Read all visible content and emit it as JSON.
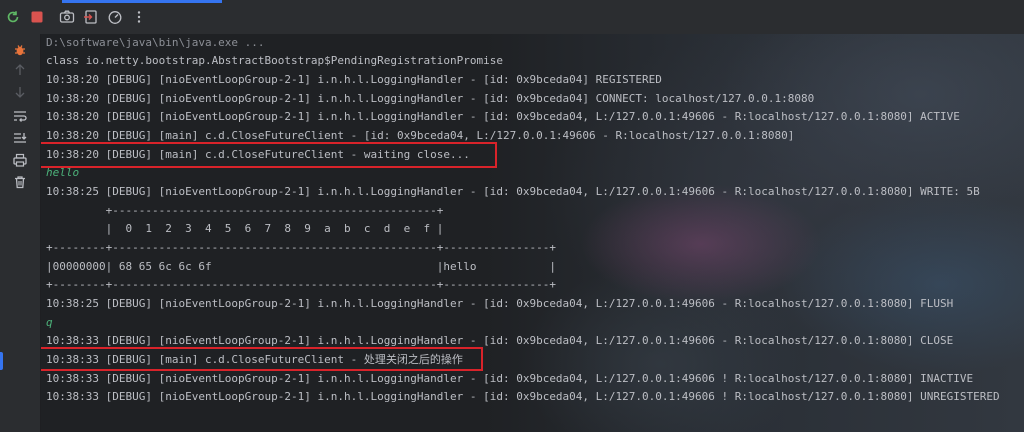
{
  "toolbar": {
    "buttons": [
      {
        "name": "rerun-icon",
        "color": "#5fb865"
      },
      {
        "name": "stop-icon",
        "color": "#d9534f"
      },
      {
        "name": "camera-icon",
        "color": "#bcbec4"
      },
      {
        "name": "exit-icon",
        "color": "#bcbec4"
      },
      {
        "name": "dashboard-icon",
        "color": "#bcbec4"
      },
      {
        "name": "more-icon",
        "color": "#bcbec4"
      }
    ]
  },
  "gutter": {
    "buttons": [
      "bug-icon",
      "arrow-up-icon",
      "arrow-down-icon",
      "soft-wrap-icon",
      "scroll-to-end-icon",
      "print-icon",
      "trash-icon"
    ]
  },
  "console": {
    "lines": [
      {
        "text": "D:\\software\\java\\bin\\java.exe ...",
        "style": "gray"
      },
      {
        "text": "class io.netty.bootstrap.AbstractBootstrap$PendingRegistrationPromise",
        "style": "normal"
      },
      {
        "text": "10:38:20 [DEBUG] [nioEventLoopGroup-2-1] i.n.h.l.LoggingHandler - [id: 0x9bceda04] REGISTERED",
        "style": "normal"
      },
      {
        "text": "10:38:20 [DEBUG] [nioEventLoopGroup-2-1] i.n.h.l.LoggingHandler - [id: 0x9bceda04] CONNECT: localhost/127.0.0.1:8080",
        "style": "normal"
      },
      {
        "text": "10:38:20 [DEBUG] [nioEventLoopGroup-2-1] i.n.h.l.LoggingHandler - [id: 0x9bceda04, L:/127.0.0.1:49606 - R:localhost/127.0.0.1:8080] ACTIVE",
        "style": "normal"
      },
      {
        "text": "10:38:20 [DEBUG] [main] c.d.CloseFutureClient - [id: 0x9bceda04, L:/127.0.0.1:49606 - R:localhost/127.0.0.1:8080]",
        "style": "normal"
      },
      {
        "text": "10:38:20 [DEBUG] [main] c.d.CloseFutureClient - waiting close...",
        "style": "normal"
      },
      {
        "text": "hello",
        "style": "italic"
      },
      {
        "text": "10:38:25 [DEBUG] [nioEventLoopGroup-2-1] i.n.h.l.LoggingHandler - [id: 0x9bceda04, L:/127.0.0.1:49606 - R:localhost/127.0.0.1:8080] WRITE: 5B",
        "style": "normal"
      },
      {
        "text": "         +-------------------------------------------------+",
        "style": "normal"
      },
      {
        "text": "         |  0  1  2  3  4  5  6  7  8  9  a  b  c  d  e  f |",
        "style": "normal"
      },
      {
        "text": "+--------+-------------------------------------------------+----------------+",
        "style": "normal"
      },
      {
        "text": "|00000000| 68 65 6c 6c 6f                                  |hello           |",
        "style": "normal"
      },
      {
        "text": "+--------+-------------------------------------------------+----------------+",
        "style": "normal"
      },
      {
        "text": "10:38:25 [DEBUG] [nioEventLoopGroup-2-1] i.n.h.l.LoggingHandler - [id: 0x9bceda04, L:/127.0.0.1:49606 - R:localhost/127.0.0.1:8080] FLUSH",
        "style": "normal"
      },
      {
        "text": "q",
        "style": "italic"
      },
      {
        "text": "10:38:33 [DEBUG] [nioEventLoopGroup-2-1] i.n.h.l.LoggingHandler - [id: 0x9bceda04, L:/127.0.0.1:49606 - R:localhost/127.0.0.1:8080] CLOSE",
        "style": "normal"
      },
      {
        "text": "10:38:33 [DEBUG] [main] c.d.CloseFutureClient - 处理关闭之后的操作",
        "style": "normal"
      },
      {
        "text": "10:38:33 [DEBUG] [nioEventLoopGroup-2-1] i.n.h.l.LoggingHandler - [id: 0x9bceda04, L:/127.0.0.1:49606 ! R:localhost/127.0.0.1:8080] INACTIVE",
        "style": "normal"
      },
      {
        "text": "10:38:33 [DEBUG] [nioEventLoopGroup-2-1] i.n.h.l.LoggingHandler - [id: 0x9bceda04, L:/127.0.0.1:49606 ! R:localhost/127.0.0.1:8080] UNREGISTERED",
        "style": "normal"
      }
    ],
    "highlight_color": "#d9232a"
  }
}
